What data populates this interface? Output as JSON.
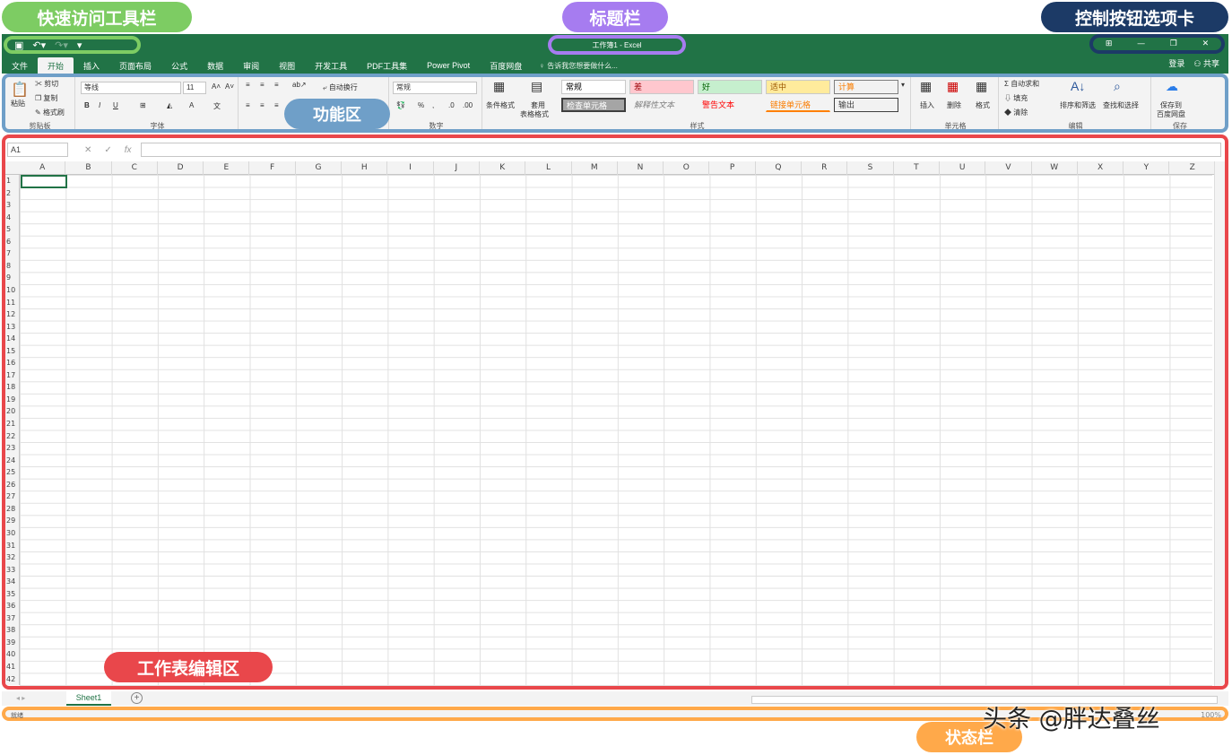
{
  "annotations": {
    "quick_access": "快速访问工具栏",
    "title_bar": "标题栏",
    "control_buttons": "控制按钮选项卡",
    "ribbon": "功能区",
    "sheet_area": "工作表编辑区",
    "status_bar": "状态栏"
  },
  "window": {
    "title": "工作簿1 - Excel",
    "login": "登录",
    "share": "共享"
  },
  "tabs": [
    "文件",
    "开始",
    "插入",
    "页面布局",
    "公式",
    "数据",
    "审阅",
    "视图",
    "开发工具",
    "PDF工具集",
    "Power Pivot",
    "百度网盘"
  ],
  "tell_me": "告诉我您想要做什么...",
  "ribbon": {
    "clipboard": {
      "paste": "粘贴",
      "cut": "剪切",
      "copy": "复制",
      "format_painter": "格式刷",
      "group": "剪贴板"
    },
    "font": {
      "name": "等线",
      "size": "11",
      "group": "字体"
    },
    "alignment": {
      "wrap": "自动换行"
    },
    "number": {
      "format": "常规",
      "group": "数字"
    },
    "styles": {
      "conditional": "条件格式",
      "table": "套用",
      "table2": "表格格式",
      "items": [
        "常规",
        "差",
        "好",
        "适中",
        "计算",
        "检查单元格",
        "解释性文本",
        "警告文本",
        "链接单元格",
        "输出"
      ],
      "group": "样式"
    },
    "cells": {
      "insert": "插入",
      "delete": "删除",
      "format": "格式",
      "group": "单元格"
    },
    "editing": {
      "autosum": "自动求和",
      "fill": "填充",
      "clear": "清除",
      "sort": "排序和筛选",
      "find": "查找和选择",
      "group": "编辑"
    },
    "save": {
      "line1": "保存到",
      "line2": "百度网盘",
      "group": "保存"
    }
  },
  "namebox": "A1",
  "columns": [
    "A",
    "B",
    "C",
    "D",
    "E",
    "F",
    "G",
    "H",
    "I",
    "J",
    "K",
    "L",
    "M",
    "N",
    "O",
    "P",
    "Q",
    "R",
    "S",
    "T",
    "U",
    "V",
    "W",
    "X",
    "Y",
    "Z"
  ],
  "rows": [
    "1",
    "2",
    "3",
    "4",
    "5",
    "6",
    "7",
    "8",
    "9",
    "10",
    "11",
    "12",
    "13",
    "14",
    "15",
    "16",
    "17",
    "18",
    "19",
    "20",
    "21",
    "22",
    "23",
    "24",
    "25",
    "26",
    "27",
    "28",
    "29",
    "30",
    "31",
    "32",
    "33",
    "34",
    "35",
    "36",
    "37",
    "38",
    "39",
    "40",
    "41",
    "42"
  ],
  "sheet_tab": "Sheet1",
  "status": {
    "ready": "就绪",
    "zoom": "100%"
  },
  "watermark": "头条 @胖达叠丝",
  "colors": {
    "excel_green": "#217346",
    "quick": "#7dcc63",
    "title": "#a67cf0",
    "control": "#1c3a66",
    "ribbon": "#6f9fc8",
    "sheet": "#e9474b",
    "status": "#ffa94a"
  }
}
